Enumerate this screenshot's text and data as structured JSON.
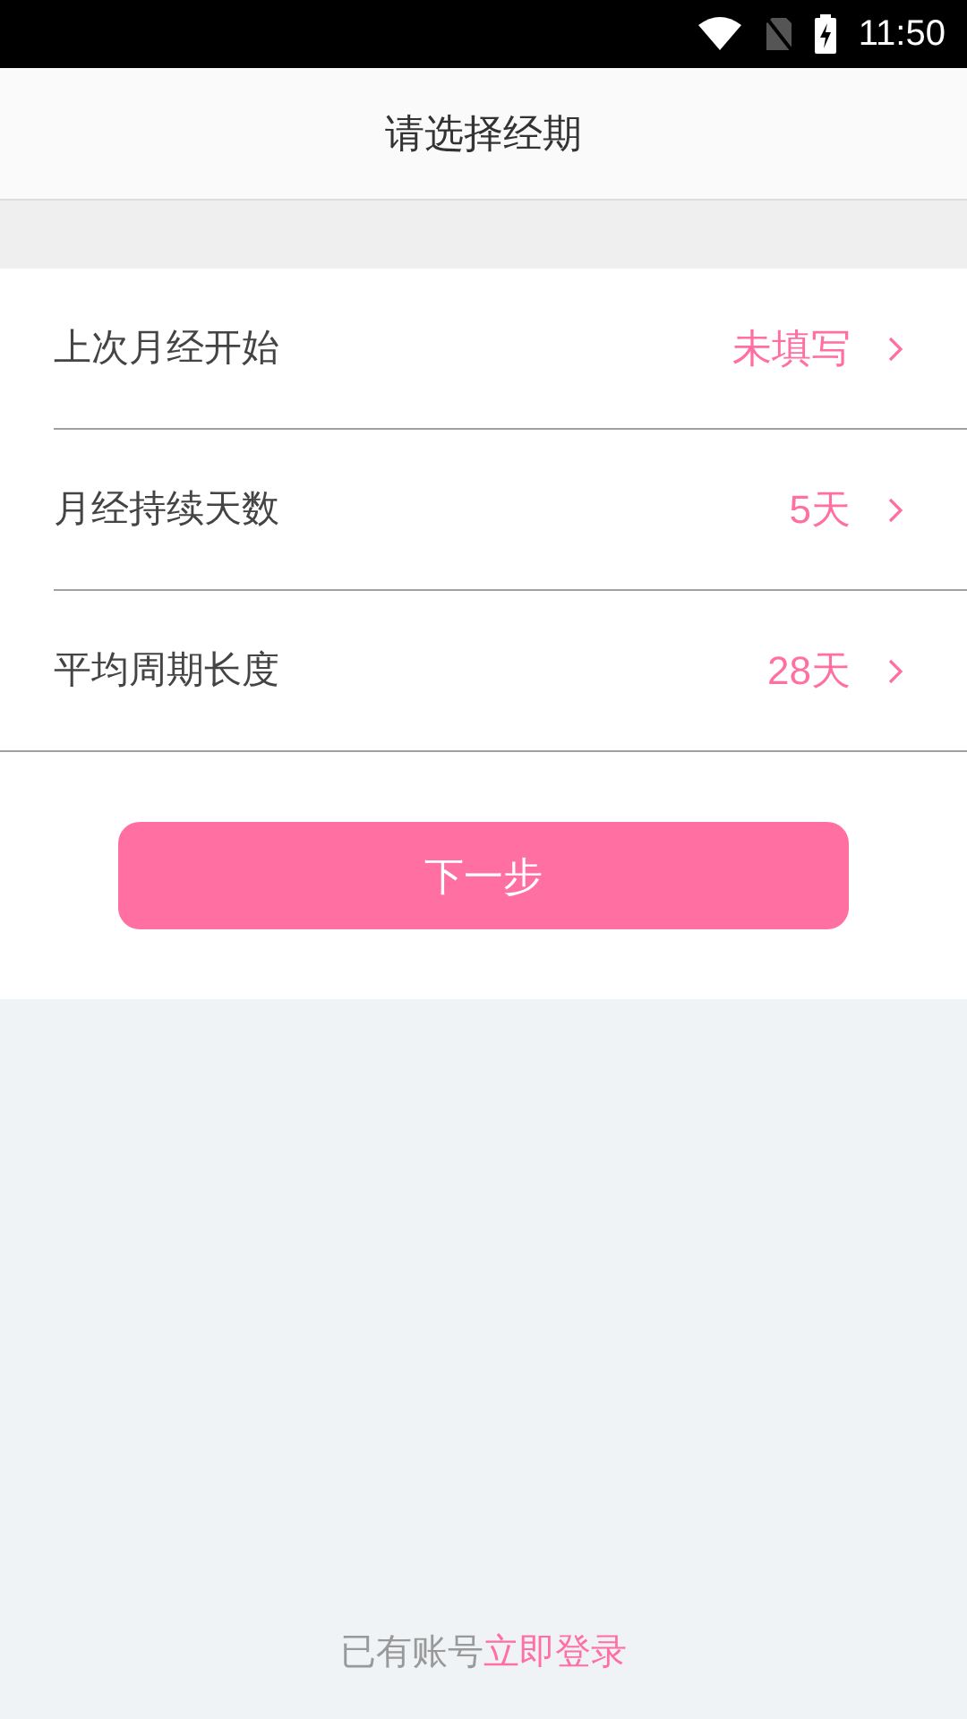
{
  "status_bar": {
    "time": "11:50"
  },
  "header": {
    "title": "请选择经期"
  },
  "rows": [
    {
      "label": "上次月经开始",
      "value": "未填写"
    },
    {
      "label": "月经持续天数",
      "value": "5天"
    },
    {
      "label": "平均周期长度",
      "value": "28天"
    }
  ],
  "next_button": {
    "label": "下一步"
  },
  "footer": {
    "text": "已有账号",
    "link": "立即登录"
  }
}
